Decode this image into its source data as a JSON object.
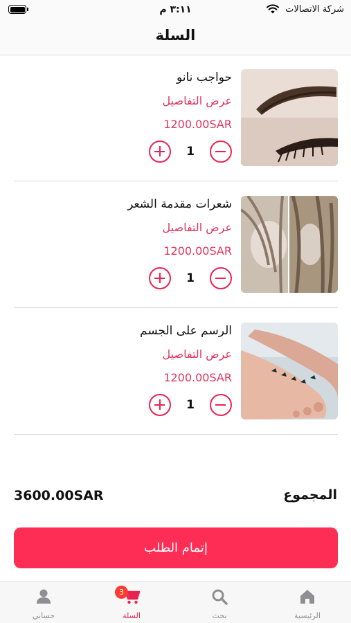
{
  "status_bar": {
    "carrier": "شركة الاتصالات",
    "time": "٣:١١ م"
  },
  "header": {
    "title": "السلة"
  },
  "cart": {
    "items": [
      {
        "name": "حواجب نانو",
        "details_link": "عرض التفاصيل",
        "price": "1200.00SAR",
        "quantity": "1",
        "image_icon": "eyebrow-photo"
      },
      {
        "name": "شعرات مقدمة الشعر",
        "details_link": "عرض التفاصيل",
        "price": "1200.00SAR",
        "quantity": "1",
        "image_icon": "hairline-photo"
      },
      {
        "name": "الرسم على الجسم",
        "details_link": "عرض التفاصيل",
        "price": "1200.00SAR",
        "quantity": "1",
        "image_icon": "foot-tattoo-photo"
      }
    ]
  },
  "summary": {
    "total_label": "المجموع",
    "total_value": "3600.00SAR",
    "checkout_label": "إتمام الطلب"
  },
  "tab_bar": {
    "tabs": [
      {
        "label": "الرئيسية",
        "icon": "home-icon"
      },
      {
        "label": "بحث",
        "icon": "search-icon"
      },
      {
        "label": "السلة",
        "icon": "cart-icon",
        "badge": "3",
        "active": true
      },
      {
        "label": "حسابي",
        "icon": "person-icon"
      }
    ]
  },
  "colors": {
    "accent": "#fd2d55",
    "price": "#e0345c",
    "badge": "#ff3b30"
  }
}
